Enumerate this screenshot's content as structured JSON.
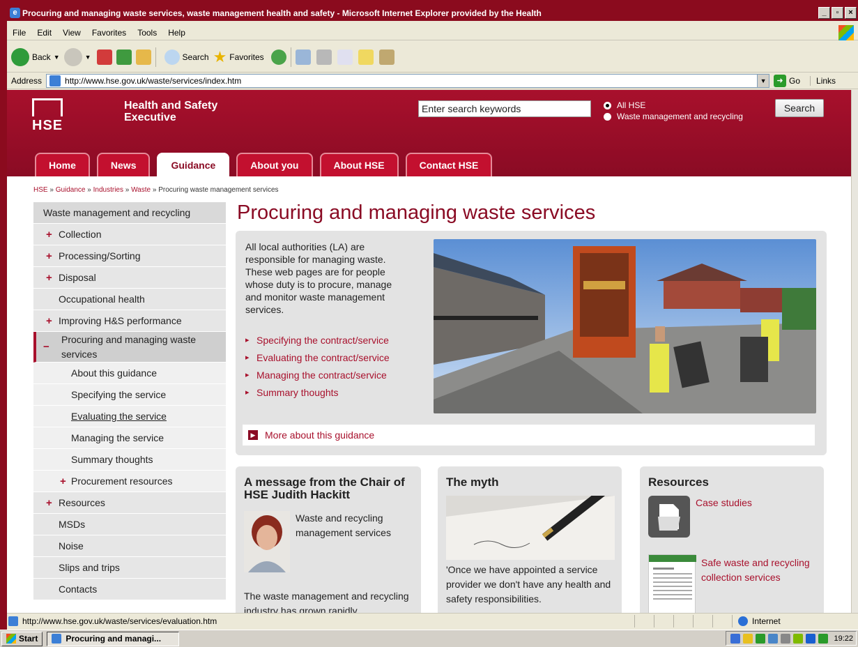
{
  "window": {
    "title": "Procuring and managing waste services, waste management health and safety - Microsoft Internet Explorer provided by the Health"
  },
  "menu": [
    "File",
    "Edit",
    "View",
    "Favorites",
    "Tools",
    "Help"
  ],
  "toolbar": {
    "back": "Back",
    "search": "Search",
    "favorites": "Favorites"
  },
  "address": {
    "label": "Address",
    "url": "http://www.hse.gov.uk/waste/services/index.htm",
    "go": "Go",
    "links": "Links"
  },
  "header": {
    "logo_text": "HSE",
    "org_name": "Health and Safety Executive",
    "search_value": "Enter search keywords",
    "radio_all": "All HSE",
    "radio_waste": "Waste management and recycling",
    "search_button": "Search"
  },
  "tabs": [
    {
      "label": "Home",
      "active": false
    },
    {
      "label": "News",
      "active": false
    },
    {
      "label": "Guidance",
      "active": true
    },
    {
      "label": "About you",
      "active": false
    },
    {
      "label": "About HSE",
      "active": false
    },
    {
      "label": "Contact HSE",
      "active": false
    }
  ],
  "breadcrumb": {
    "items": [
      "HSE",
      "Guidance",
      "Industries",
      "Waste"
    ],
    "current": "Procuring waste management services"
  },
  "leftnav": {
    "title": "Waste management and recycling",
    "items": [
      {
        "label": "Collection",
        "marker": "+"
      },
      {
        "label": "Processing/Sorting",
        "marker": "+"
      },
      {
        "label": "Disposal",
        "marker": "+"
      },
      {
        "label": "Occupational health",
        "marker": ""
      },
      {
        "label": "Improving H&S performance",
        "marker": "+"
      },
      {
        "label": "Procuring and managing waste services",
        "marker": "−"
      },
      {
        "label": "About this guidance",
        "marker": ""
      },
      {
        "label": "Specifying the service",
        "marker": ""
      },
      {
        "label": "Evaluating the service",
        "marker": ""
      },
      {
        "label": "Managing the service",
        "marker": ""
      },
      {
        "label": "Summary thoughts",
        "marker": ""
      },
      {
        "label": "Procurement resources",
        "marker": "+"
      },
      {
        "label": "Resources",
        "marker": "+"
      },
      {
        "label": "MSDs",
        "marker": ""
      },
      {
        "label": "Noise",
        "marker": ""
      },
      {
        "label": "Slips and trips",
        "marker": ""
      },
      {
        "label": "Contacts",
        "marker": ""
      }
    ]
  },
  "main": {
    "heading": "Procuring and managing waste services",
    "intro": "All local authorities (LA) are responsible for managing waste. These web pages are for people whose duty is to procure, manage and monitor waste management services.",
    "links": [
      "Specifying the contract/service",
      "Evaluating the contract/service",
      "Managing the contract/service",
      "Summary thoughts"
    ],
    "more": "More about this guidance"
  },
  "cards": {
    "chair": {
      "title": "A message from the Chair of HSE Judith Hackitt",
      "text1": "Waste and recycling management services",
      "text2": "The waste management and recycling industry has grown rapidly"
    },
    "myth": {
      "title": "The myth",
      "text": "'Once we have appointed a service provider we don't have any health and safety responsibilities."
    },
    "resources": {
      "title": "Resources",
      "link1": "Case studies",
      "link2": "Safe waste and recycling collection services"
    }
  },
  "status": {
    "url": "http://www.hse.gov.uk/waste/services/evaluation.htm",
    "zone": "Internet"
  },
  "taskbar": {
    "start": "Start",
    "item": "Procuring and managi...",
    "time": "19:22"
  }
}
